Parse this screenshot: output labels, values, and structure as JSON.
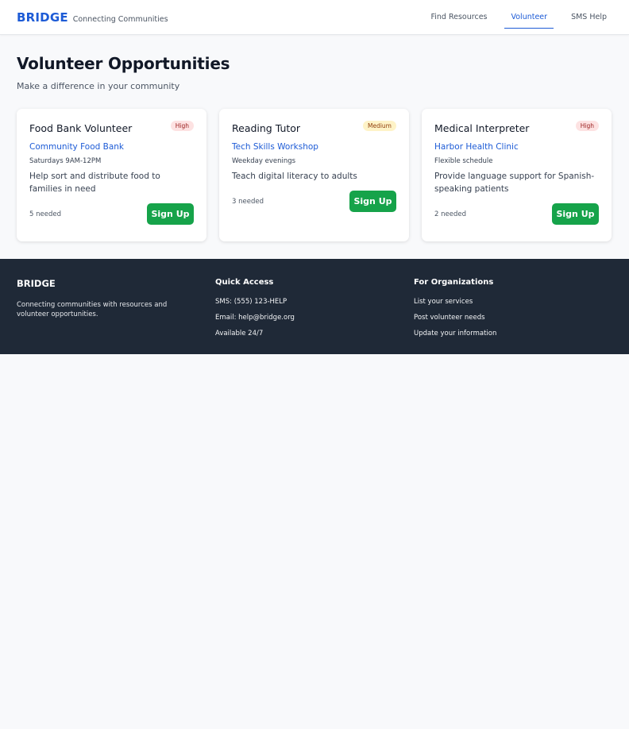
{
  "header": {
    "logo": "BRIDGE",
    "tagline": "Connecting Communities",
    "nav": [
      {
        "label": "Find Resources",
        "active": false
      },
      {
        "label": "Volunteer",
        "active": true
      },
      {
        "label": "SMS Help",
        "active": false
      }
    ]
  },
  "main": {
    "title": "Volunteer Opportunities",
    "subtitle": "Make a difference in your community",
    "opportunities": [
      {
        "title": "Food Bank Volunteer",
        "priority": "High",
        "organization": "Community Food Bank",
        "schedule": "Saturdays 9AM-12PM",
        "description": "Help sort and distribute food to families in need",
        "needed": "5 needed",
        "button": "Sign Up"
      },
      {
        "title": "Reading Tutor",
        "priority": "Medium",
        "organization": "Tech Skills Workshop",
        "schedule": "Weekday evenings",
        "description": "Teach digital literacy to adults",
        "needed": "3 needed",
        "button": "Sign Up"
      },
      {
        "title": "Medical Interpreter",
        "priority": "High",
        "organization": "Harbor Health Clinic",
        "schedule": "Flexible schedule",
        "description": "Provide language support for Spanish-speaking patients",
        "needed": "2 needed",
        "button": "Sign Up"
      }
    ]
  },
  "footer": {
    "brand": "BRIDGE",
    "description": "Connecting communities with resources and volunteer opportunities.",
    "quick_access": {
      "heading": "Quick Access",
      "items": [
        "SMS: (555) 123-HELP",
        "Email: help@bridge.org",
        "Available 24/7"
      ]
    },
    "organizations": {
      "heading": "For Organizations",
      "items": [
        "List your services",
        "Post volunteer needs",
        "Update your information"
      ]
    }
  },
  "colors": {
    "brand_blue": "#1d5bd6",
    "signup_green": "#16a34a",
    "footer_bg": "#1f2937",
    "badge_high_bg": "#fde2e2",
    "badge_medium_bg": "#fef3c7"
  }
}
